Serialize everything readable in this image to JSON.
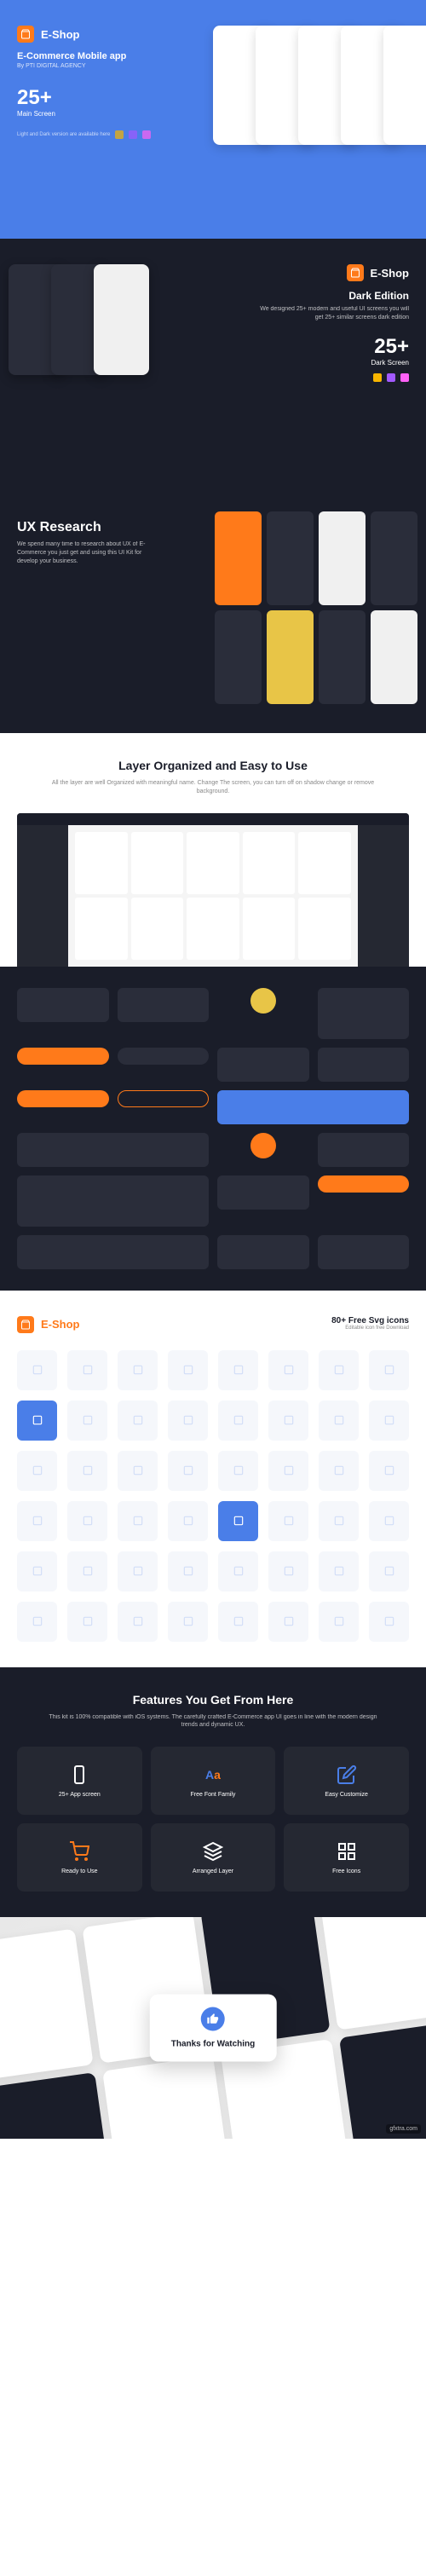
{
  "brand": {
    "name": "E-Shop",
    "accent_color": "#ff7a1a",
    "primary_color": "#4a7ee8",
    "dark_bg": "#1a1d29"
  },
  "hero": {
    "title": "E-Commerce Mobile app",
    "subtitle": "By PTI DIGITAL AGENCY",
    "count": "25+",
    "count_label": "Main Screen",
    "note": "Light and Dark version are available here"
  },
  "dark": {
    "title": "Dark Edition",
    "description": "We designed 25+ modern and useful UI screens you will get 25+ similar screens dark edition",
    "count": "25+",
    "count_label": "Dark Screen"
  },
  "ux": {
    "title": "UX Research",
    "description": "We spend many time to research about UX of E-Commerce you just get and using this UI Kit for develop your business."
  },
  "layer": {
    "title": "Layer Organized and Easy to Use",
    "description": "All the layer are well Organized with meaningful name. Change The screen, you can turn off on shadow change or remove background."
  },
  "icons": {
    "title": "80+ Free Svg icons",
    "subtitle": "Editable icon free Download",
    "count": 48
  },
  "features": {
    "title": "Features You Get From Here",
    "description": "This kit is 100% compatible with iOS systems. The carefully crafted E-Commerce app UI goes in line with the modern design trends and dynamic UX.",
    "items": [
      {
        "label": "25+ App screen",
        "icon": "phone"
      },
      {
        "label": "Free Font Family",
        "icon": "font"
      },
      {
        "label": "Easy Customize",
        "icon": "edit"
      },
      {
        "label": "Ready to Use",
        "icon": "cart"
      },
      {
        "label": "Arranged Layer",
        "icon": "layers"
      },
      {
        "label": "Free Icons",
        "icon": "grid"
      }
    ]
  },
  "thanks": {
    "text": "Thanks for Watching"
  },
  "watermark": "gfxtra.com"
}
